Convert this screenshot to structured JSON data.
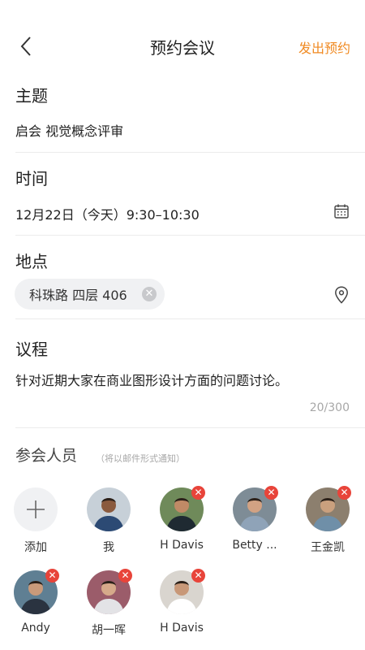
{
  "header": {
    "title": "预约会议",
    "send_label": "发出预约"
  },
  "topic": {
    "label": "主题",
    "value": "启会 视觉概念评审"
  },
  "time": {
    "label": "时间",
    "value": "12月22日（今天）9:30–10:30"
  },
  "location": {
    "label": "地点",
    "chip": "科珠路 四层 406"
  },
  "agenda": {
    "label": "议程",
    "value": "针对近期大家在商业图形设计方面的问题讨论。",
    "counter": "20/300"
  },
  "attendees": {
    "label": "参会人员",
    "hint": "（将以邮件形式通知）",
    "add_label": "添加",
    "people": [
      {
        "name": "我",
        "removable": false,
        "bg": "#c7d0d8",
        "shirt": "#2c4a74",
        "skin": "#8a5a3e"
      },
      {
        "name": "H Davis",
        "removable": true,
        "bg": "#6f8a5a",
        "shirt": "#1f2a32",
        "skin": "#c08a66"
      },
      {
        "name": "Betty ...",
        "removable": true,
        "bg": "#7e8c96",
        "shirt": "#8fa3b8",
        "skin": "#d2a283"
      },
      {
        "name": "王金凯",
        "removable": true,
        "bg": "#8c7f6e",
        "shirt": "#6f8fa8",
        "skin": "#caa07e"
      },
      {
        "name": "Andy",
        "removable": true,
        "bg": "#5f7f93",
        "shirt": "#2a3340",
        "skin": "#c99a7a"
      },
      {
        "name": "胡一晖",
        "removable": true,
        "bg": "#9b5c6a",
        "shirt": "#e3e3e6",
        "skin": "#d6a98a"
      },
      {
        "name": "H Davis",
        "removable": true,
        "bg": "#d9d5cf",
        "shirt": "#ffffff",
        "skin": "#c89878"
      }
    ]
  },
  "colors": {
    "accent": "#f08a22",
    "remove": "#e8443a"
  }
}
